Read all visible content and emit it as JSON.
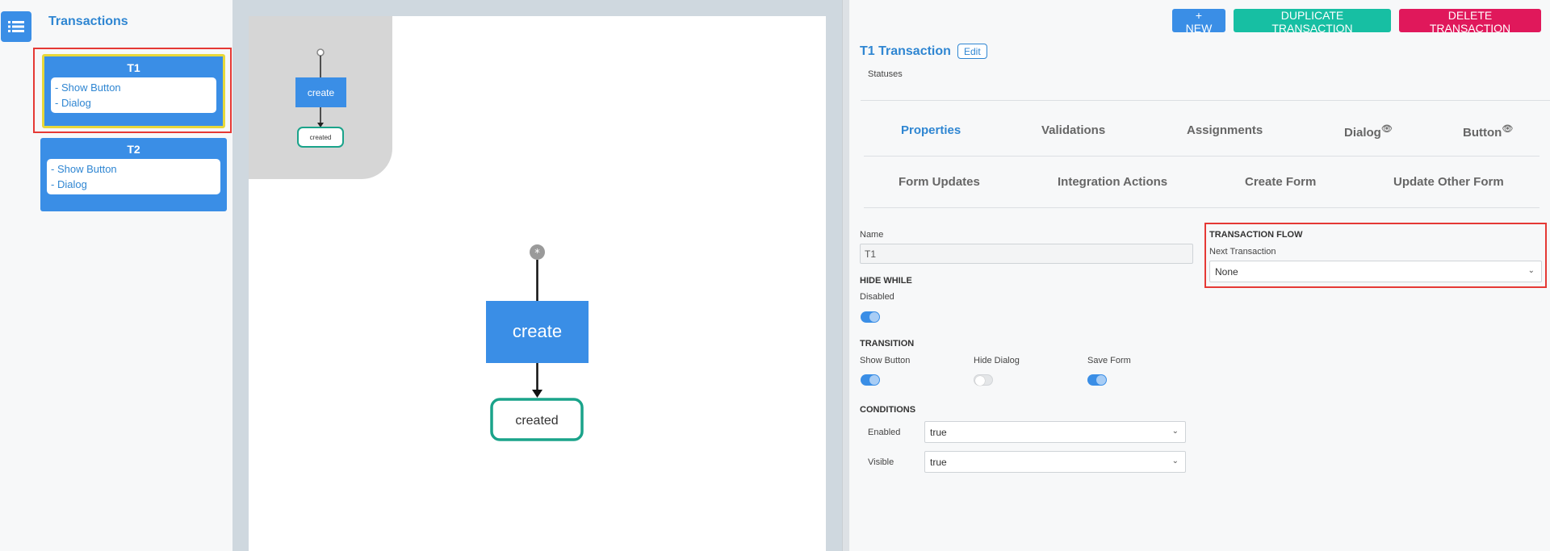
{
  "sidebar": {
    "menu_icon": "list-icon",
    "title": "Transactions",
    "transactions": [
      {
        "name": "T1",
        "items": [
          "- Show Button",
          "- Dialog"
        ],
        "selected": true
      },
      {
        "name": "T2",
        "items": [
          "- Show Button",
          "- Dialog"
        ],
        "selected": false
      }
    ]
  },
  "canvas": {
    "minimap": {
      "node_label": "create",
      "status_label": "created"
    },
    "flow": {
      "node_label": "create",
      "status_label": "created",
      "start_icon": "asterisk-icon"
    }
  },
  "toolbar": {
    "new_label": "+ NEW",
    "duplicate_label": "DUPLICATE TRANSACTION",
    "delete_label": "DELETE TRANSACTION"
  },
  "detail": {
    "title": "T1 Transaction",
    "edit_label": "Edit",
    "statuses_label": "Statuses",
    "tabs_row1": [
      {
        "label": "Properties",
        "active": true,
        "eye": false
      },
      {
        "label": "Validations",
        "active": false,
        "eye": false
      },
      {
        "label": "Assignments",
        "active": false,
        "eye": false
      },
      {
        "label": "Dialog",
        "active": false,
        "eye": true
      },
      {
        "label": "Button",
        "active": false,
        "eye": true
      }
    ],
    "tabs_row2": [
      {
        "label": "Form Updates"
      },
      {
        "label": "Integration Actions"
      },
      {
        "label": "Create Form"
      },
      {
        "label": "Update Other Form"
      }
    ],
    "name_label": "Name",
    "name_value": "T1",
    "hide_while": {
      "section": "HIDE WHILE",
      "disabled_label": "Disabled",
      "disabled_on": true
    },
    "transition": {
      "section": "TRANSITION",
      "show_button_label": "Show Button",
      "show_button_on": true,
      "hide_dialog_label": "Hide Dialog",
      "hide_dialog_on": false,
      "save_form_label": "Save Form",
      "save_form_on": true
    },
    "conditions": {
      "section": "CONDITIONS",
      "enabled_label": "Enabled",
      "enabled_value": "true",
      "visible_label": "Visible",
      "visible_value": "true"
    },
    "transaction_flow": {
      "section": "TRANSACTION FLOW",
      "next_label": "Next Transaction",
      "next_value": "None"
    }
  },
  "colors": {
    "primary": "#3a8ee6",
    "teal": "#17bfa3",
    "danger": "#e0185b",
    "status_border": "#1aa38a"
  }
}
